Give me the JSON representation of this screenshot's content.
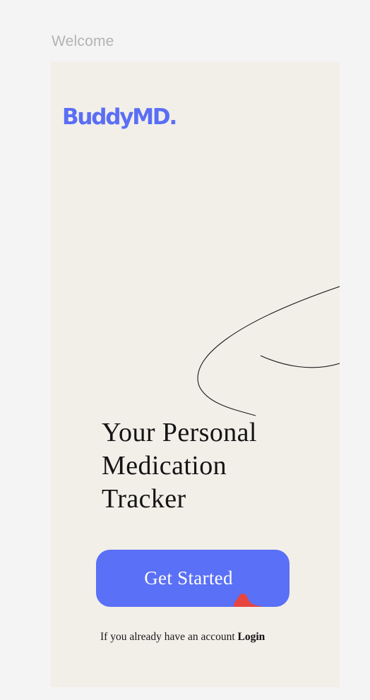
{
  "frame": {
    "label": "Welcome"
  },
  "brand": {
    "logo_text": "BuddyMD.",
    "accent_color": "#5a6ef5"
  },
  "hero": {
    "headline_lines": [
      "Your Personal",
      "Medication",
      "Tracker"
    ]
  },
  "cta": {
    "label": "Get Started",
    "color": "#5a70f6"
  },
  "login": {
    "prompt": "If you already have an account",
    "link_label": "Login"
  },
  "colors": {
    "page_background": "#f4f4f4",
    "screen_background": "#f2efe9",
    "decor_blob": "#e64540"
  }
}
